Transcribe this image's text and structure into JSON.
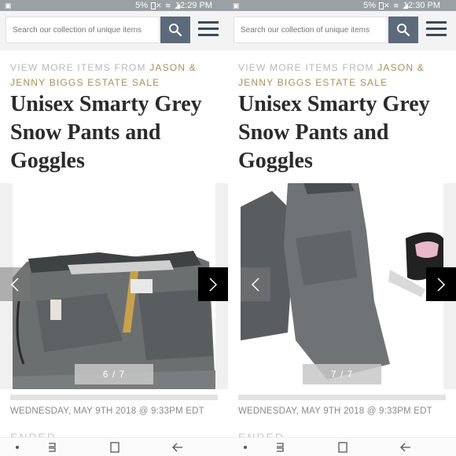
{
  "screens": [
    {
      "status": {
        "battery": "5%",
        "time": "12:29 PM"
      },
      "search": {
        "placeholder": "Search our collection of unique items"
      },
      "store": {
        "prefix": "VIEW MORE ITEMS FROM ",
        "seller": "JASON & JENNY BIGGS ESTATE SALE"
      },
      "title": "Unisex Smarty Grey Snow Pants and Goggles",
      "gallery": {
        "counter": "6 / 7"
      },
      "date": "WEDNESDAY, MAY 9TH 2018 @ 9:33PM EDT",
      "status_label": "ENDED"
    },
    {
      "status": {
        "battery": "5%",
        "time": "12:30 PM"
      },
      "search": {
        "placeholder": "Search our collection of unique items"
      },
      "store": {
        "prefix": "VIEW MORE ITEMS FROM ",
        "seller": "JASON & JENNY BIGGS ESTATE SALE"
      },
      "title": "Unisex Smarty Grey Snow Pants and Goggles",
      "gallery": {
        "counter": "7 / 7"
      },
      "date": "WEDNESDAY, MAY 9TH 2018 @ 9:33PM EDT",
      "status_label": "ENDED"
    }
  ],
  "colors": {
    "search_button": "#5d6a7b",
    "menu_icon": "#3b4a5c",
    "seller_link": "#a88f5e",
    "status_bar": "#9aa0a4"
  },
  "icons": [
    "search-icon",
    "menu-icon",
    "chevron-left-icon",
    "chevron-right-icon",
    "back-icon",
    "home-icon",
    "recent-apps-icon"
  ]
}
